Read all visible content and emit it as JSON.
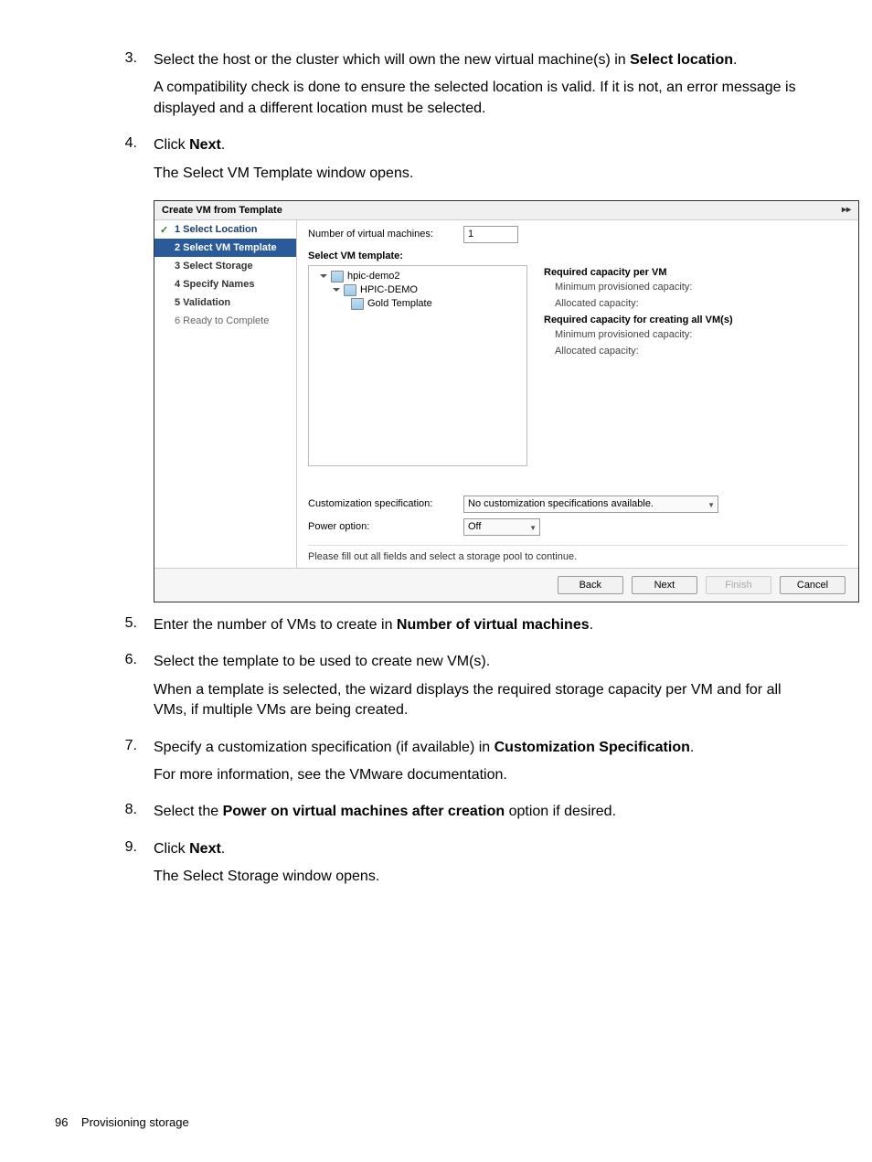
{
  "steps": {
    "s3": {
      "text_a": "Select the host or the cluster which will own the new virtual machine(s) in ",
      "bold_a": "Select location",
      "text_b": ".",
      "para2": "A compatibility check is done to ensure the selected location is valid. If it is not, an error message is displayed and a different location must be selected."
    },
    "s4": {
      "text_a": "Click ",
      "bold_a": "Next",
      "text_b": ".",
      "para2": "The Select VM Template window opens."
    },
    "s5": {
      "text_a": "Enter the number of VMs to create in ",
      "bold_a": "Number of virtual machines",
      "text_b": "."
    },
    "s6": {
      "para1": "Select the template to be used to create new VM(s).",
      "para2": "When a template is selected, the wizard displays the required storage capacity per VM and for all VMs, if multiple VMs are being created."
    },
    "s7": {
      "text_a": "Specify a customization specification (if available) in ",
      "bold_a": "Customization Specification",
      "text_b": ".",
      "para2": "For more information, see the VMware documentation."
    },
    "s8": {
      "text_a": "Select the ",
      "bold_a": "Power on virtual machines after creation",
      "text_b": " option if desired."
    },
    "s9": {
      "text_a": "Click ",
      "bold_a": "Next",
      "text_b": ".",
      "para2": "The Select Storage window opens."
    }
  },
  "wizard": {
    "title": "Create VM from Template",
    "nav": {
      "step1": "1  Select Location",
      "step2": "2  Select VM Template",
      "step3": "3  Select Storage",
      "step4": "4  Specify Names",
      "step5": "5  Validation",
      "step6": "6  Ready to Complete"
    },
    "num_label": "Number of virtual machines:",
    "num_value": "1",
    "select_template": "Select VM template:",
    "tree": {
      "n1": "hpic-demo2",
      "n2": "HPIC-DEMO",
      "n3": "Gold Template"
    },
    "rp": {
      "h1": "Required capacity per VM",
      "i1": "Minimum provisioned capacity:",
      "i2": "Allocated capacity:",
      "h2": "Required capacity for creating all VM(s)",
      "i3": "Minimum provisioned capacity:",
      "i4": "Allocated capacity:"
    },
    "cust_label": "Customization specification:",
    "cust_value": "No customization specifications available.",
    "power_label": "Power option:",
    "power_value": "Off",
    "hint": "Please fill out all fields and select a storage pool to continue.",
    "btn_back": "Back",
    "btn_next": "Next",
    "btn_finish": "Finish",
    "btn_cancel": "Cancel"
  },
  "footer": {
    "page": "96",
    "section": "Provisioning storage"
  },
  "nums": {
    "n3": "3.",
    "n4": "4.",
    "n5": "5.",
    "n6": "6.",
    "n7": "7.",
    "n8": "8.",
    "n9": "9."
  }
}
